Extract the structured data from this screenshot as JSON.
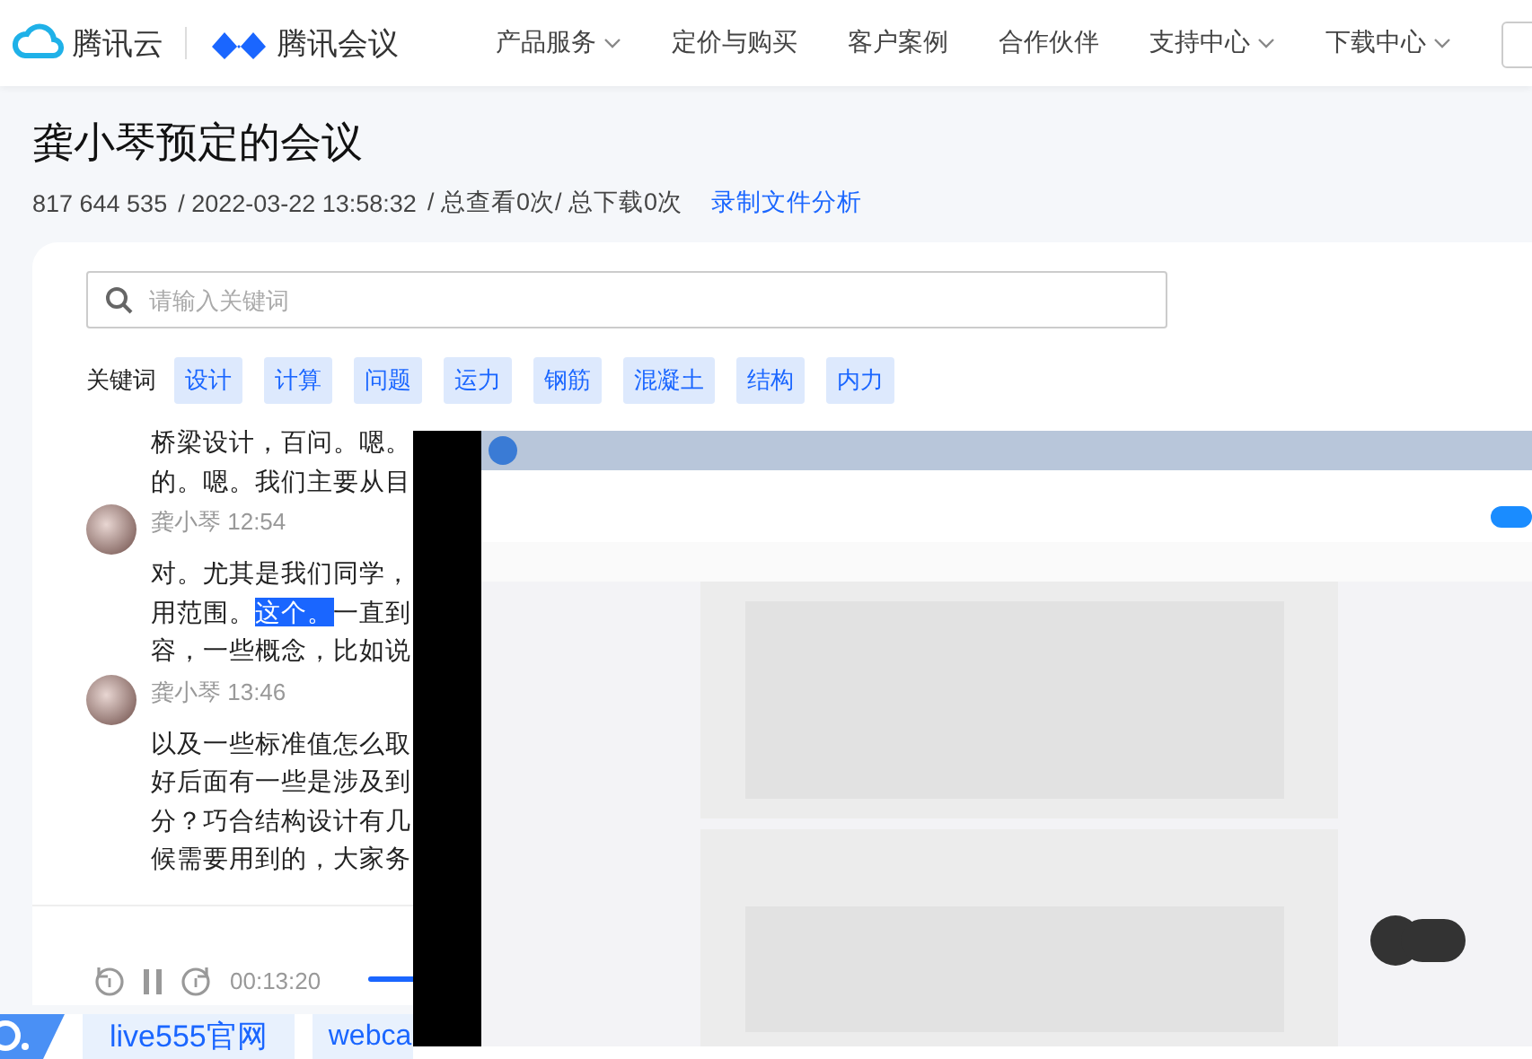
{
  "header": {
    "brand": "腾讯云",
    "product": "腾讯会议",
    "nav": [
      {
        "label": "产品服务",
        "dropdown": true
      },
      {
        "label": "定价与购买",
        "dropdown": false
      },
      {
        "label": "客户案例",
        "dropdown": false
      },
      {
        "label": "合作伙伴",
        "dropdown": false
      },
      {
        "label": "支持中心",
        "dropdown": true
      },
      {
        "label": "下载中心",
        "dropdown": true
      }
    ]
  },
  "meeting": {
    "title": "龚小琴预定的会议",
    "id": "817 644 535",
    "date": "/ 2022-03-22 13:58:32",
    "stats": "/ 总查看0次/ 总下载0次",
    "analysis_link": "录制文件分析"
  },
  "search": {
    "placeholder": "请输入关键词"
  },
  "keywords": {
    "label": "关键词",
    "tags": [
      "设计",
      "计算",
      "问题",
      "运力",
      "钢筋",
      "混凝土",
      "结构",
      "内力"
    ]
  },
  "transcript": [
    {
      "lines": [
        [
          {
            "text": "桥梁设计，百问。嗯。",
            "highlighted": false
          }
        ],
        [
          {
            "text": "的。嗯。我们主要从目",
            "highlighted": false
          }
        ]
      ]
    },
    {
      "speaker": "龚小琴",
      "time": "12:54",
      "lines": [
        [
          {
            "text": "对。尤其是我们同学，",
            "highlighted": false
          }
        ],
        [
          {
            "text": "用范围。",
            "highlighted": false
          },
          {
            "text": "这个。",
            "highlighted": true
          },
          {
            "text": "一直到",
            "highlighted": false
          }
        ],
        [
          {
            "text": "容，一些概念，比如说",
            "highlighted": false
          }
        ]
      ]
    },
    {
      "speaker": "龚小琴",
      "time": "13:46",
      "lines": [
        [
          {
            "text": "以及一些标准值怎么取",
            "highlighted": false
          }
        ],
        [
          {
            "text": "好后面有一些是涉及到",
            "highlighted": false
          }
        ],
        [
          {
            "text": "分？巧合结构设计有几",
            "highlighted": false
          }
        ],
        [
          {
            "text": "候需要用到的，大家务",
            "highlighted": false
          }
        ]
      ]
    }
  ],
  "player": {
    "time": "00:13:20",
    "playing": true
  },
  "links": [
    "live555官网",
    "webca"
  ],
  "video": {
    "kind": "picture"
  }
}
